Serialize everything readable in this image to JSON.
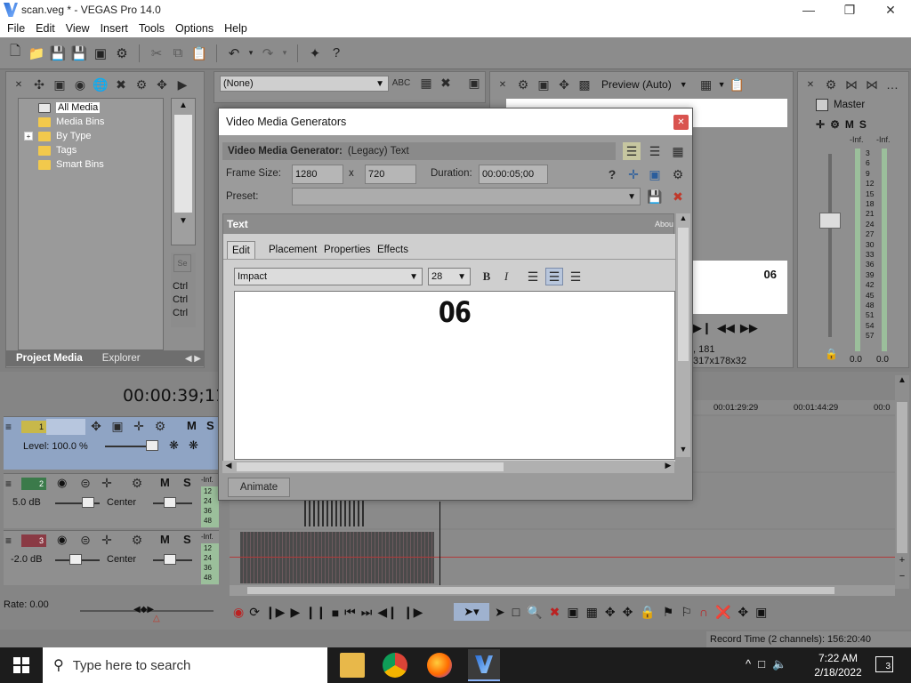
{
  "window": {
    "title": "scan.veg * - VEGAS Pro 14.0"
  },
  "menu": [
    "File",
    "Edit",
    "View",
    "Insert",
    "Tools",
    "Options",
    "Help"
  ],
  "media_panel": {
    "tree": [
      "All Media",
      "Media Bins",
      "By Type",
      "Tags",
      "Smart Bins"
    ],
    "tabs": [
      "Project Media",
      "Explorer"
    ],
    "side_labels": [
      "Ctrl",
      "Ctrl",
      "Ctrl"
    ]
  },
  "fx_panel": {
    "preset": "(None)"
  },
  "preview": {
    "mode": "Preview (Auto)",
    "overlay_text": "06",
    "coords": ", 181",
    "size": "317x178x32"
  },
  "master": {
    "label": "Master",
    "inf_left": "-Inf.",
    "inf_right": "-Inf.",
    "ticks": [
      "3",
      "6",
      "9",
      "12",
      "15",
      "18",
      "21",
      "24",
      "27",
      "30",
      "33",
      "36",
      "39",
      "42",
      "45",
      "48",
      "51",
      "54",
      "57"
    ],
    "bottom_left": "0.0",
    "bottom_right": "0.0"
  },
  "dialog": {
    "title": "Video Media Generators",
    "generator_label": "Video Media Generator:",
    "generator_value": "(Legacy) Text",
    "frame_size_label": "Frame Size:",
    "width": "1280",
    "x": "x",
    "height": "720",
    "duration_label": "Duration:",
    "duration": "00:00:05;00",
    "preset_label": "Preset:",
    "text_header": "Text",
    "about": "Abou",
    "tabs": [
      "Edit",
      "Placement",
      "Properties",
      "Effects"
    ],
    "font": "Impact",
    "size": "28",
    "content": "06",
    "animate": "Animate"
  },
  "timeline": {
    "timecode": "00:00:39;11",
    "ruler": [
      "00:01:29:29",
      "00:01:44:29",
      "00:0"
    ],
    "tracks": [
      {
        "num": "1",
        "level": "Level: 100.0 %"
      },
      {
        "num": "2",
        "db": "5.0 dB",
        "pan": "Center",
        "inf": "-Inf.",
        "meter": [
          "12",
          "24",
          "36",
          "48"
        ]
      },
      {
        "num": "3",
        "db": "-2.0 dB",
        "pan": "Center",
        "inf": "-Inf.",
        "meter": [
          "12",
          "24",
          "36",
          "48"
        ]
      }
    ],
    "rate": "Rate: 0.00"
  },
  "status": {
    "record_time": "Record Time (2 channels): 156:20:40"
  },
  "taskbar": {
    "search_placeholder": "Type here to search",
    "time": "7:22 AM",
    "date": "2/18/2022",
    "notif": "3"
  }
}
